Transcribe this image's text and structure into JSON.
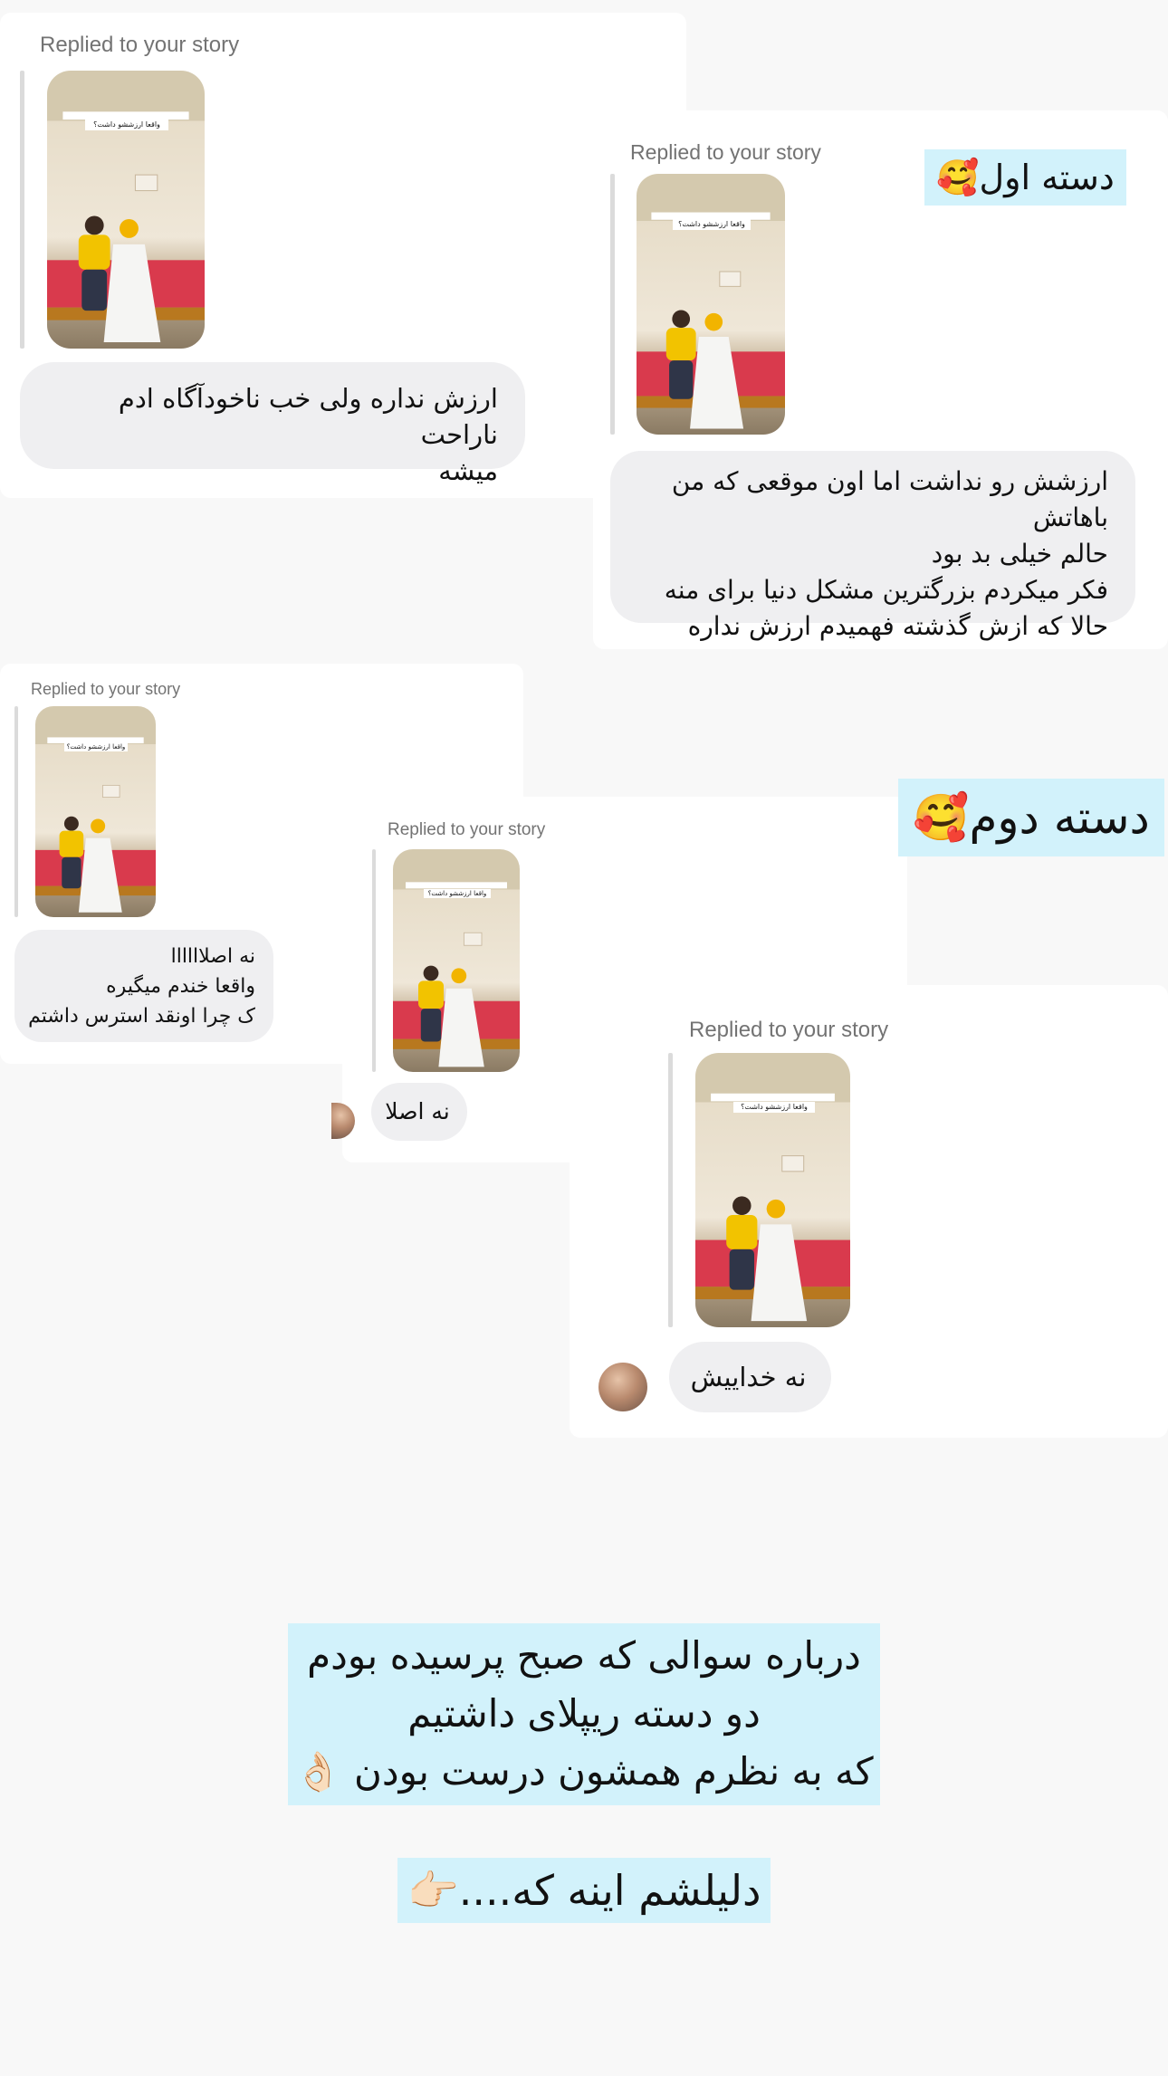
{
  "labels": {
    "group1": "دسته اول🥰",
    "group2": "دسته دوم🥰"
  },
  "messages": [
    {
      "replied": "Replied to your story",
      "story_text": "واقعا ارزششو داشت؟",
      "text": "ارزش نداره ولی خب ناخودآگاه ادم ناراحت\nمیشه"
    },
    {
      "replied": "Replied to your story",
      "story_text": "واقعا ارزششو داشت؟",
      "text": "ارزشش رو نداشت اما اون موقعی که من باهاتش\nحالم خیلی بد بود\nفکر میکردم بزرگترین مشکل دنیا برای منه\nحالا که ازش گذشته فهمیدم ارزش نداره"
    },
    {
      "replied": "Replied to your story",
      "story_text": "واقعا ارزششو داشت؟",
      "text": "نه اصلاااااا\nواقعا خندم میگیره\nک چرا اونقد استرس داشتم"
    },
    {
      "replied": "Replied to your story",
      "story_text": "واقعا ارزششو داشت؟",
      "text": "نه اصلا"
    },
    {
      "replied": "Replied to your story",
      "story_text": "واقعا ارزششو داشت؟",
      "text": "نه خداییش"
    }
  ],
  "caption": {
    "main": "درباره سوالی که صبح پرسیده بودم\nدو دسته ریپلای داشتیم\nکه به نظرم همشون درست بودن 👌🏻",
    "reason": "دلیلشم اینه که....👉🏻"
  },
  "colors": {
    "label_bg": "#d2f2fb",
    "bubble_bg": "#efeff1",
    "replied_text": "#737373",
    "page_bg": "#f8f8f8"
  }
}
